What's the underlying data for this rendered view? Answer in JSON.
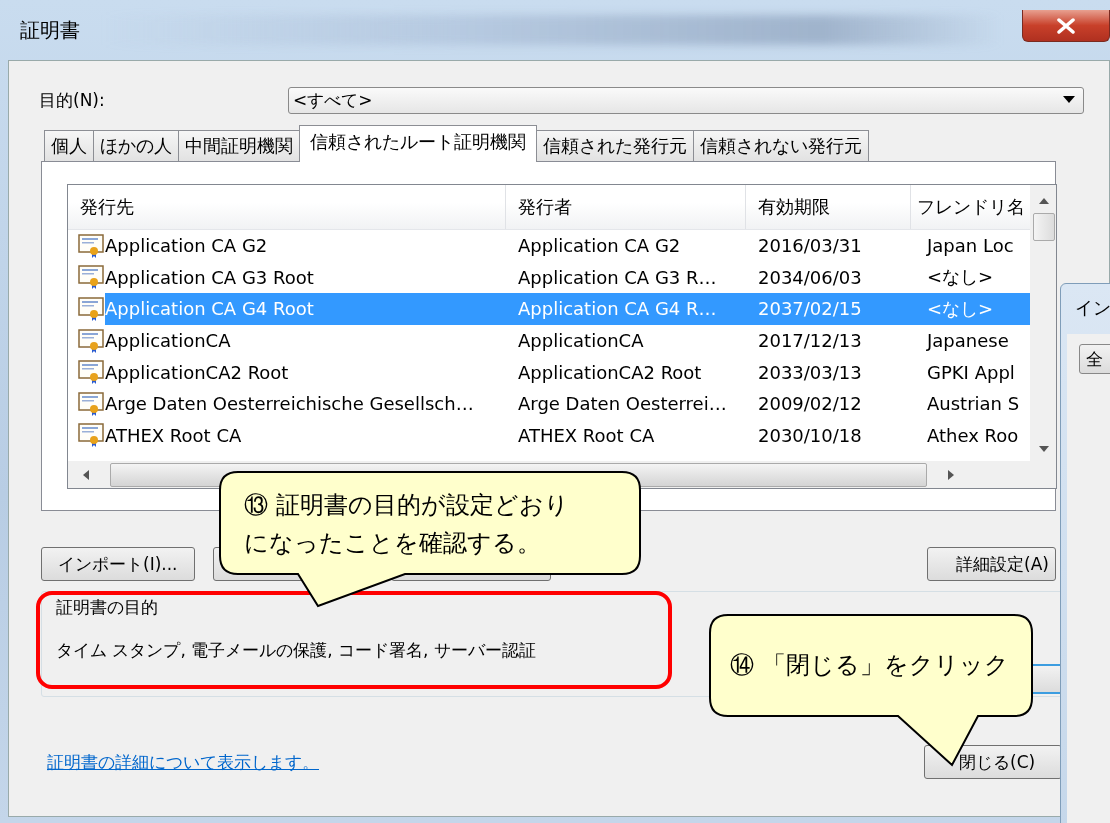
{
  "window": {
    "title": "証明書"
  },
  "purpose": {
    "label": "目的(N):",
    "value": "<すべて>"
  },
  "tabs": [
    {
      "label": "個人",
      "selected": false
    },
    {
      "label": "ほかの人",
      "selected": false
    },
    {
      "label": "中間証明機関",
      "selected": false
    },
    {
      "label": "信頼されたルート証明機関",
      "selected": true
    },
    {
      "label": "信頼された発行元",
      "selected": false
    },
    {
      "label": "信頼されない発行元",
      "selected": false
    }
  ],
  "table": {
    "columns": [
      "発行先",
      "発行者",
      "有効期限",
      "フレンドリ名"
    ],
    "rows": [
      {
        "cells": [
          "Application CA G2",
          "Application CA G2",
          "2016/03/31",
          "Japan Loc"
        ],
        "selected": false
      },
      {
        "cells": [
          "Application CA G3 Root",
          "Application CA G3 R…",
          "2034/06/03",
          "<なし>"
        ],
        "selected": false
      },
      {
        "cells": [
          "Application CA G4 Root",
          "Application CA G4 R…",
          "2037/02/15",
          "<なし>"
        ],
        "selected": true
      },
      {
        "cells": [
          "ApplicationCA",
          "ApplicationCA",
          "2017/12/13",
          "Japanese"
        ],
        "selected": false
      },
      {
        "cells": [
          "ApplicationCA2 Root",
          "ApplicationCA2 Root",
          "2033/03/13",
          "GPKI Appl"
        ],
        "selected": false
      },
      {
        "cells": [
          "Arge Daten Oesterreichische Gesellsch…",
          "Arge Daten Oesterrei…",
          "2009/02/12",
          "Austrian S"
        ],
        "selected": false
      },
      {
        "cells": [
          "ATHEX Root CA",
          "ATHEX Root CA",
          "2030/10/18",
          "Athex Roo"
        ],
        "selected": false
      }
    ]
  },
  "buttons": [
    {
      "kind": "text",
      "label": "インポート(I)..."
    },
    {
      "kind": "covered"
    },
    {
      "kind": "covered"
    },
    {
      "kind": "text",
      "label": "詳細設定(A)"
    }
  ],
  "purpose_group": {
    "legend": "証明書の目的",
    "text": "タイム スタンプ, 電子メールの保護, コード署名, サーバー認証"
  },
  "details_link": "証明書の詳細について表示します。",
  "close_button": "閉じる(C)",
  "background_window": {
    "title": "イン",
    "button": "全"
  },
  "annotations": [
    {
      "kind": "highlight"
    },
    {
      "kind": "callout",
      "lines": [
        "⑬  証明書の目的が設定どおり",
        "になったことを確認する。"
      ]
    },
    {
      "kind": "callout",
      "lines": [
        "⑭ 「閉じる」をクリック"
      ]
    }
  ]
}
